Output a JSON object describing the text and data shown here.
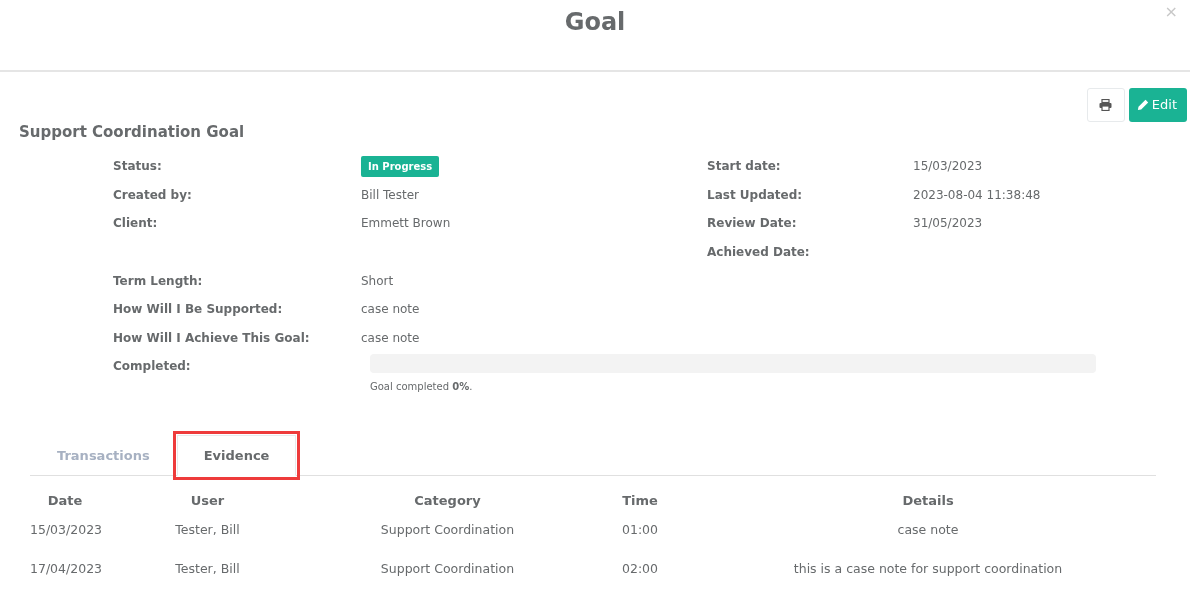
{
  "modal": {
    "title": "Goal",
    "close": "×"
  },
  "toolbar": {
    "edit_label": "Edit"
  },
  "goal_title": "Support Coordination Goal",
  "fields_left": [
    {
      "kind": "badge",
      "label": "Status:",
      "value": "In Progress",
      "color": "#1ab394"
    },
    {
      "kind": "text",
      "label": "Created by:",
      "value": "Bill Tester"
    },
    {
      "kind": "text",
      "label": "Client:",
      "value": "Emmett Brown"
    },
    {
      "kind": "blank"
    },
    {
      "kind": "text",
      "label": "Term Length:",
      "value": "Short"
    },
    {
      "kind": "text",
      "label": "How Will I Be Supported:",
      "value": "case note"
    },
    {
      "kind": "text",
      "label": "How Will I Achieve This Goal:",
      "value": "case note"
    },
    {
      "kind": "progress",
      "label": "Completed:",
      "level": 0,
      "caption": "Goal completed **0%**."
    }
  ],
  "fields_right": [
    {
      "label": "Start date:",
      "value": "15/03/2023"
    },
    {
      "label": "Last Updated:",
      "value": "2023-08-04 11:38:48"
    },
    {
      "label": "Review Date:",
      "value": "31/05/2023"
    },
    {
      "label": "Achieved Date:"
    }
  ],
  "tabs": [
    {
      "label": "Transactions",
      "selected": false,
      "highlighted": false
    },
    {
      "label": "Evidence",
      "selected": true,
      "highlighted": true
    }
  ],
  "table": {
    "columns": [
      "Date",
      "User",
      "Category",
      "Time",
      "Details"
    ],
    "rows": [
      [
        "15/03/2023",
        "Tester, Bill",
        "Support Coordination",
        "01:00",
        "case note"
      ],
      [
        "17/04/2023",
        "Tester, Bill",
        "Support Coordination",
        "02:00",
        "this is a case note for support coordination"
      ]
    ]
  }
}
